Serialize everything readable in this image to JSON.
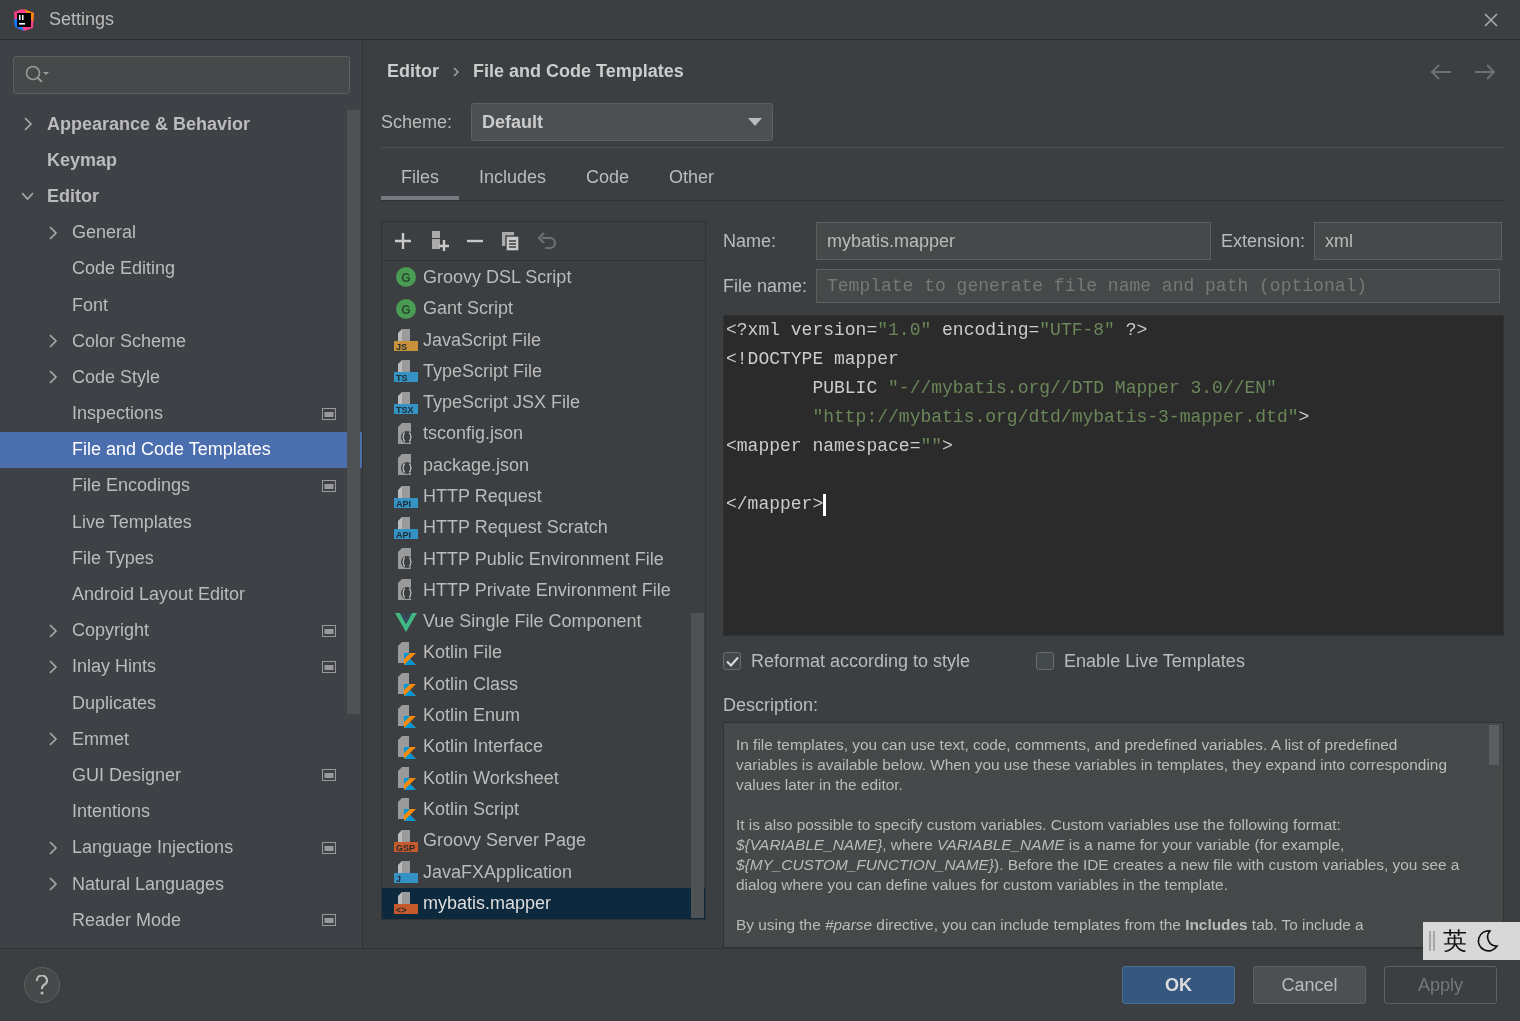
{
  "window": {
    "title": "Settings"
  },
  "sidebar": {
    "items": [
      {
        "label": "Appearance & Behavior",
        "kind": "folder",
        "expanded": false,
        "bold": true,
        "selected": false
      },
      {
        "label": "Keymap",
        "kind": "leaf",
        "bold": true,
        "selected": false
      },
      {
        "label": "Editor",
        "kind": "folder",
        "expanded": true,
        "bold": true,
        "selected": false,
        "children": [
          {
            "label": "General",
            "kind": "folder",
            "expanded": false,
            "selected": false
          },
          {
            "label": "Code Editing",
            "kind": "leaf",
            "selected": false
          },
          {
            "label": "Font",
            "kind": "leaf",
            "selected": false
          },
          {
            "label": "Color Scheme",
            "kind": "folder",
            "expanded": false,
            "selected": false
          },
          {
            "label": "Code Style",
            "kind": "folder",
            "expanded": false,
            "selected": false
          },
          {
            "label": "Inspections",
            "kind": "leaf",
            "selected": false,
            "project_level": true
          },
          {
            "label": "File and Code Templates",
            "kind": "leaf",
            "selected": true
          },
          {
            "label": "File Encodings",
            "kind": "leaf",
            "selected": false,
            "project_level": true
          },
          {
            "label": "Live Templates",
            "kind": "leaf",
            "selected": false
          },
          {
            "label": "File Types",
            "kind": "leaf",
            "selected": false
          },
          {
            "label": "Android Layout Editor",
            "kind": "leaf",
            "selected": false
          },
          {
            "label": "Copyright",
            "kind": "folder",
            "expanded": false,
            "selected": false,
            "project_level": true
          },
          {
            "label": "Inlay Hints",
            "kind": "folder",
            "expanded": false,
            "selected": false,
            "project_level": true
          },
          {
            "label": "Duplicates",
            "kind": "leaf",
            "selected": false
          },
          {
            "label": "Emmet",
            "kind": "folder",
            "expanded": false,
            "selected": false
          },
          {
            "label": "GUI Designer",
            "kind": "leaf",
            "selected": false,
            "project_level": true
          },
          {
            "label": "Intentions",
            "kind": "leaf",
            "selected": false
          },
          {
            "label": "Language Injections",
            "kind": "folder",
            "expanded": false,
            "selected": false,
            "project_level": true
          },
          {
            "label": "Natural Languages",
            "kind": "folder",
            "expanded": false,
            "selected": false
          },
          {
            "label": "Reader Mode",
            "kind": "leaf",
            "selected": false,
            "project_level": true
          }
        ]
      }
    ]
  },
  "breadcrumb": [
    "Editor",
    "File and Code Templates"
  ],
  "scheme": {
    "label": "Scheme:",
    "value": "Default"
  },
  "tabs": [
    {
      "label": "Files",
      "selected": true
    },
    {
      "label": "Includes",
      "selected": false
    },
    {
      "label": "Code",
      "selected": false
    },
    {
      "label": "Other",
      "selected": false
    }
  ],
  "templates": [
    {
      "name": "Groovy DSL Script",
      "kind": "circle",
      "badge": "G",
      "color": "#499c54",
      "selected": false
    },
    {
      "name": "Gant Script",
      "kind": "circle",
      "badge": "G",
      "color": "#499c54",
      "selected": false
    },
    {
      "name": "JavaScript File",
      "kind": "badge",
      "badge": "JS",
      "color": "#c9923a",
      "selected": false
    },
    {
      "name": "TypeScript File",
      "kind": "badge",
      "badge": "TS",
      "color": "#3592c4",
      "selected": false
    },
    {
      "name": "TypeScript JSX File",
      "kind": "badge",
      "badge": "TSX",
      "color": "#3592c4",
      "selected": false
    },
    {
      "name": "tsconfig.json",
      "kind": "config",
      "selected": false
    },
    {
      "name": "package.json",
      "kind": "config",
      "selected": false
    },
    {
      "name": "HTTP Request",
      "kind": "badge",
      "badge": "API",
      "color": "#3592c4",
      "selected": false
    },
    {
      "name": "HTTP Request Scratch",
      "kind": "badge",
      "badge": "API",
      "color": "#3592c4",
      "selected": false
    },
    {
      "name": "HTTP Public Environment File",
      "kind": "config",
      "selected": false
    },
    {
      "name": "HTTP Private Environment File",
      "kind": "config",
      "selected": false
    },
    {
      "name": "Vue Single File Component",
      "kind": "vue",
      "selected": false
    },
    {
      "name": "Kotlin File",
      "kind": "kotlin",
      "selected": false
    },
    {
      "name": "Kotlin Class",
      "kind": "kotlin",
      "selected": false
    },
    {
      "name": "Kotlin Enum",
      "kind": "kotlin",
      "selected": false
    },
    {
      "name": "Kotlin Interface",
      "kind": "kotlin",
      "selected": false
    },
    {
      "name": "Kotlin Worksheet",
      "kind": "kotlin",
      "selected": false
    },
    {
      "name": "Kotlin Script",
      "kind": "kotlin",
      "selected": false
    },
    {
      "name": "Groovy Server Page",
      "kind": "badge",
      "badge": "GSP",
      "color": "#c75a2a",
      "selected": false
    },
    {
      "name": "JavaFXApplication",
      "kind": "badge",
      "badge": "J",
      "color": "#3592c4",
      "selected": false
    },
    {
      "name": "mybatis.mapper",
      "kind": "badge",
      "badge": "<>",
      "color": "#c75a2a",
      "selected": true
    }
  ],
  "form": {
    "name_label": "Name:",
    "name_value": "mybatis.mapper",
    "extension_label": "Extension:",
    "extension_value": "xml",
    "file_name_label": "File name:",
    "file_name_placeholder": "Template to generate file name and path (optional)"
  },
  "code": [
    {
      "kind": "text",
      "segments": [
        {
          "text": "<?xml version=",
          "kind": "plain"
        },
        {
          "text": "\"1.0\"",
          "kind": "string"
        },
        {
          "text": " encoding=",
          "kind": "plain"
        },
        {
          "text": "\"UTF-8\"",
          "kind": "string"
        },
        {
          "text": " ?>",
          "kind": "plain"
        }
      ]
    },
    {
      "kind": "text",
      "segments": [
        {
          "text": "<!DOCTYPE mapper",
          "kind": "plain"
        }
      ]
    },
    {
      "kind": "text",
      "segments": [
        {
          "text": "        PUBLIC ",
          "kind": "plain"
        },
        {
          "text": "\"-//mybatis.org//DTD Mapper 3.0//EN\"",
          "kind": "string"
        }
      ]
    },
    {
      "kind": "text",
      "segments": [
        {
          "text": "        \"http://mybatis.org/dtd/mybatis-3-mapper.dtd\"",
          "kind": "string"
        },
        {
          "text": ">",
          "kind": "plain"
        }
      ]
    },
    {
      "kind": "text",
      "segments": [
        {
          "text": "<mapper namespace=",
          "kind": "plain"
        },
        {
          "text": "\"\"",
          "kind": "string"
        },
        {
          "text": ">",
          "kind": "plain"
        }
      ]
    },
    {
      "kind": "blank"
    },
    {
      "kind": "text",
      "caret": true,
      "segments": [
        {
          "text": "</mapper>",
          "kind": "plain"
        }
      ]
    }
  ],
  "options": [
    {
      "label": "Reformat according to style",
      "checked": true
    },
    {
      "label": "Enable Live Templates",
      "checked": false
    }
  ],
  "description": {
    "label": "Description:",
    "paragraphs": [
      "In file templates, you can use text, code, comments, and predefined variables. A list of predefined variables is available below. When you use these variables in templates, they expand into corresponding values later in the editor.",
      "It is also possible to specify custom variables. Custom variables use the following format: *${VARIABLE_NAME}*, where *VARIABLE_NAME* is a name for your variable (for example, *${MY_CUSTOM_FUNCTION_NAME}*). Before the IDE creates a new file with custom variables, you see a dialog where you can define values for custom variables in the template.",
      "By using the *#parse* directive, you can include templates from the **Includes** tab. To include a"
    ]
  },
  "buttons": [
    {
      "label": "OK",
      "kind": "default"
    },
    {
      "label": "Cancel",
      "kind": "normal"
    },
    {
      "label": "Apply",
      "kind": "disabled"
    }
  ],
  "ime_indicator": {
    "text": "英"
  }
}
